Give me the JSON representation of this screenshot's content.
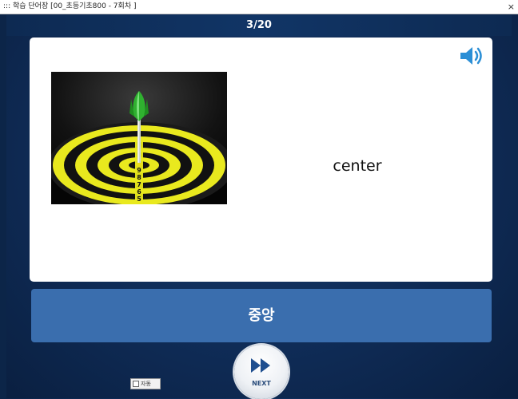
{
  "window": {
    "title": "::: 학습 단어장 [00_초등기초800 - 7회차 ]",
    "close_label": "×"
  },
  "progress": {
    "text": "3/20",
    "current": 3,
    "total": 20
  },
  "card": {
    "word": "center",
    "speaker_icon": "speaker-icon",
    "image_subject": "dartboard-with-dart"
  },
  "meaning": {
    "text": "중앙"
  },
  "controls": {
    "auto_label": "자동",
    "next_label": "NEXT"
  },
  "colors": {
    "background": "#0f2c57",
    "meaning_box": "#3a6eae",
    "accent": "#2b8fd6"
  }
}
